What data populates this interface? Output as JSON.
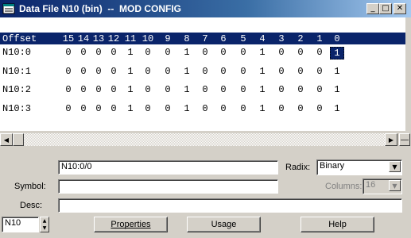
{
  "window": {
    "title": "Data File N10 (bin)  --  MOD CONFIG",
    "minimize": "_",
    "maximize": "□",
    "close": "✕",
    "title_icon": "data-file-icon"
  },
  "grid": {
    "offset_header": "Offset",
    "bit_headers": [
      "15",
      "14",
      "13",
      "12",
      "11",
      "10",
      "9",
      "8",
      "7",
      "6",
      "5",
      "4",
      "3",
      "2",
      "1",
      "0"
    ],
    "rows": [
      {
        "label": "N10:0",
        "bits": [
          "0",
          "0",
          "0",
          "0",
          "1",
          "0",
          "0",
          "1",
          "0",
          "0",
          "0",
          "1",
          "0",
          "0",
          "0",
          "1"
        ]
      },
      {
        "label": "N10:1",
        "bits": [
          "0",
          "0",
          "0",
          "0",
          "1",
          "0",
          "0",
          "1",
          "0",
          "0",
          "0",
          "1",
          "0",
          "0",
          "0",
          "1"
        ]
      },
      {
        "label": "N10:2",
        "bits": [
          "0",
          "0",
          "0",
          "0",
          "1",
          "0",
          "0",
          "1",
          "0",
          "0",
          "0",
          "1",
          "0",
          "0",
          "0",
          "1"
        ]
      },
      {
        "label": "N10:3",
        "bits": [
          "0",
          "0",
          "0",
          "0",
          "1",
          "0",
          "0",
          "1",
          "0",
          "0",
          "0",
          "1",
          "0",
          "0",
          "0",
          "1"
        ]
      }
    ],
    "selected": {
      "row": 0,
      "bit": "0"
    }
  },
  "scrollbar": {
    "left_arrow": "◀",
    "right_arrow": "▶",
    "split": "—"
  },
  "controls": {
    "address_value": "N10:0/0",
    "radix_label": "Radix:",
    "radix_value": "Binary",
    "symbol_label": "Symbol:",
    "symbol_value": "",
    "columns_label": "Columns:",
    "columns_value": "16",
    "desc_label": "Desc:",
    "desc_value": "",
    "file_value": "N10",
    "properties_label": "Properties",
    "usage_label": "Usage",
    "help_label": "Help",
    "combo_arrow": "▼",
    "spin_up": "▲",
    "spin_down": "▼"
  }
}
